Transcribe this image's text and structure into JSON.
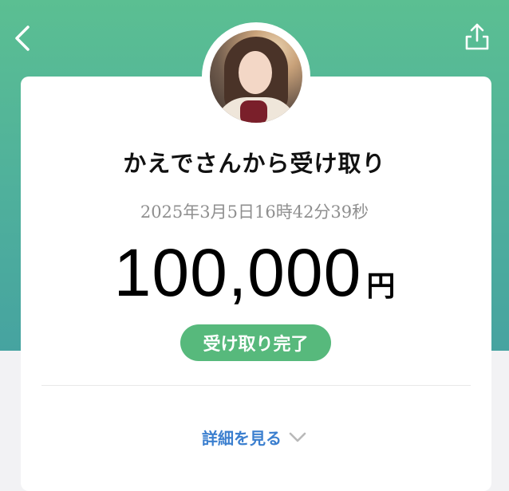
{
  "header": {
    "back_icon": "chevron-left-icon",
    "share_icon": "share-icon"
  },
  "transaction": {
    "title": "かえでさんから受け取り",
    "datetime": "2025年3月5日16時42分39秒",
    "amount": "100,000",
    "currency": "円",
    "status": "受け取り完了"
  },
  "details": {
    "label": "詳細を見る",
    "icon": "chevron-down-icon"
  },
  "colors": {
    "header_top": "#5bbf92",
    "header_bottom": "#46a3a0",
    "status_green": "#57b97c",
    "link_blue": "#3b7fcf"
  }
}
